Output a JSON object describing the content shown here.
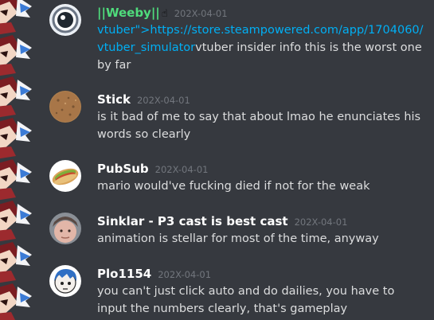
{
  "colors": {
    "background": "#36393f",
    "author_default": "#ffffff",
    "author_role": "#4fdc7c",
    "timestamp": "#72767d",
    "text": "#dcddde",
    "link": "#00aff4"
  },
  "messages": [
    {
      "author": "||Weeby||",
      "author_badge_icon": "hand-pointing-up-icon",
      "timestamp": "202X-04-01",
      "prefix_text": "vtuber\">",
      "link_text": "https://store.steampowered.com/app/1704060/vtuber_simulator",
      "text": "vtuber insider info this is the worst one by far"
    },
    {
      "author": "Stick",
      "timestamp": "202X-04-01",
      "text": "is it bad of me to say that about lmao he enunciates his words so clearly"
    },
    {
      "author": "PubSub",
      "timestamp": "202X-04-01",
      "text": "mario would've fucking died if not for the weak"
    },
    {
      "author": "Sinklar - P3 cast is best cast",
      "timestamp": "202X-04-01",
      "text": "animation is stellar for most of the time, anyway"
    },
    {
      "author": "Plo1154",
      "timestamp": "202X-04-01",
      "text": "you can't just click auto and do dailies, you have to input the numbers clearly, that's gameplay"
    }
  ]
}
